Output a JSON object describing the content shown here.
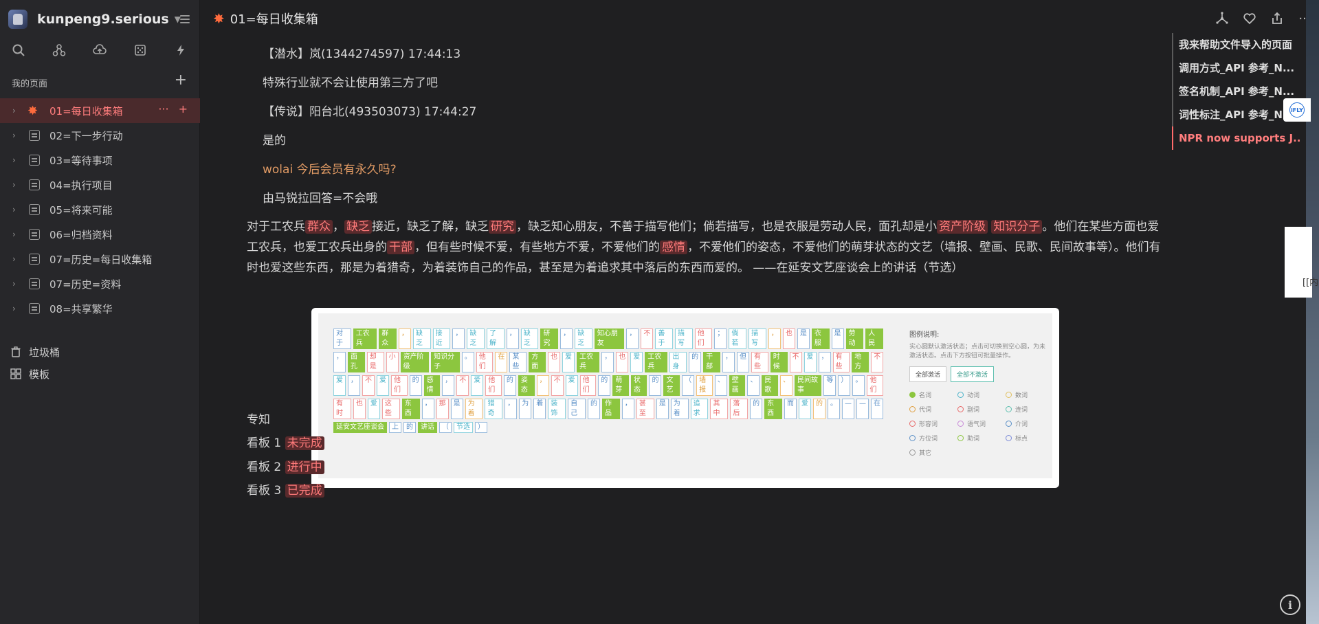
{
  "workspace": {
    "name": "kunpeng9.serious"
  },
  "sidebar": {
    "section_title": "我的页面",
    "pages": [
      {
        "label": "01=每日收集箱",
        "active": true,
        "icon": "spark-icon"
      },
      {
        "label": "02=下一步行动"
      },
      {
        "label": "03=等待事项"
      },
      {
        "label": "04=执行项目"
      },
      {
        "label": "05=将来可能"
      },
      {
        "label": "06=归档资料"
      },
      {
        "label": "07=历史=每日收集箱"
      },
      {
        "label": "07=历史=资料"
      },
      {
        "label": "08=共享繁华"
      }
    ],
    "trash_label": "垃圾桶",
    "templates_label": "模板"
  },
  "doc": {
    "title": "01=每日收集箱",
    "chat": [
      "【潜水】岚(1344274597)  17:44:13",
      "特殊行业就不会让使用第三方了吧",
      "【传说】阳台北(493503073)  17:44:27",
      "是的",
      "wolai 今后会员有永久吗?",
      "由马锐拉回答=不会哦"
    ],
    "para": {
      "t1": "对于工农兵",
      "h1": "群众",
      "t2": "，",
      "h2": "缺乏",
      "t3": "接近，缺乏了解，缺乏",
      "h3": "研究",
      "t4": "，缺乏知心朋友，不善于描写他们；倘若描写，也是衣服是劳动人民，面孔却是小",
      "h4": "资产阶级",
      "h5": "知识分子",
      "t5": "。他们在某些方面也爱工农兵，也爱工农兵出身的",
      "h6": "干部",
      "t6": "，但有些时候不爱，有些地方不爱，不爱他们的",
      "h7": "感情",
      "t7": "，不爱他们的姿态，不爱他们的萌芽状态的文艺（墙报、壁画、民歌、民间故事等）。他们有时也爱这些东西，那是为着猎奇，为着装饰自己的作品，甚至是为着追求其中落后的东西而爱的。 ——在延安文艺座谈会上的讲话（节选）"
    },
    "screenshot": {
      "rows": [
        [
          "对于",
          "工农兵",
          "群众",
          "，",
          "缺乏",
          "接近",
          "，",
          "缺乏",
          "了解",
          "，",
          "缺乏",
          "研究",
          "，",
          "缺乏",
          "知心朋友",
          "，",
          "不",
          "善于",
          "描写",
          "他们",
          "；",
          "倘若",
          "描写",
          "，",
          "也",
          "是",
          "衣服",
          "是",
          "劳动",
          "人民"
        ],
        [
          "，",
          "面孔",
          "却是",
          "小",
          "资产阶级",
          "知识分子",
          "。",
          "他们",
          "在",
          "某些",
          "方面",
          "也",
          "爱",
          "工农兵",
          "，",
          "也",
          "爱",
          "工农兵",
          "出身",
          "的",
          "干部",
          "，",
          "但",
          "有些",
          "时候",
          "不",
          "爱",
          "，",
          "有些",
          "地方",
          "不"
        ],
        [
          "爱",
          "，",
          "不",
          "爱",
          "他们",
          "的",
          "感情",
          "，",
          "不",
          "爱",
          "他们",
          "的",
          "姿态",
          "，",
          "不",
          "爱",
          "他们",
          "的",
          "萌芽",
          "状态",
          "的",
          "文艺",
          "（",
          "墙报",
          "、",
          "壁画",
          "、",
          "民歌",
          "、",
          "民间故事",
          "等",
          "）",
          "。",
          "他们"
        ],
        [
          "有时",
          "也",
          "爱",
          "这些",
          "东西",
          "，",
          "那",
          "是",
          "为着",
          "猎奇",
          "，",
          "为",
          "着",
          "装饰",
          "自己",
          "的",
          "作品",
          "，",
          "甚至",
          "是",
          "为着",
          "追求",
          "其中",
          "落后",
          "的",
          "东西",
          "而",
          "爱",
          "的",
          "。",
          "—",
          "—",
          "在"
        ],
        [
          "延安文艺座谈会",
          "上",
          "的",
          "讲话",
          "（",
          "节选",
          "）"
        ]
      ],
      "legend_title": "图例说明:",
      "legend_desc": "实心圆默认激活状态；点击可切换到空心圆，为未激活状态。点击下方按钮可批量操作。",
      "btn_all_on": "全部激活",
      "btn_all_off": "全部不激活",
      "legend_items": [
        "名词",
        "动词",
        "数词",
        "代词",
        "副词",
        "连词",
        "形容词",
        "语气词",
        "介词",
        "方位词",
        "助词",
        "标点",
        "其它"
      ]
    },
    "zhuanzhi": "专知",
    "kanban": [
      {
        "prefix": "看板 1",
        "tag": "未完成"
      },
      {
        "prefix": "看板 2",
        "tag": "进行中"
      },
      {
        "prefix": "看板 3",
        "tag": "已完成"
      }
    ]
  },
  "outline": [
    "我来帮助文件导入的页面",
    "调用方式_API 参考_N...",
    "签名机制_API 参考_N...",
    "词性标注_API 参考_N...",
    "NPR now supports J..."
  ],
  "overlay": {
    "ifly": "iFLY",
    "popup_text": "[[内"
  },
  "info_label": "i"
}
